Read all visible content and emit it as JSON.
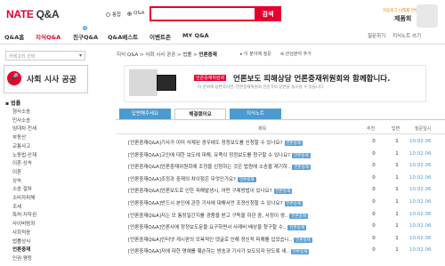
{
  "header": {
    "logo_main": "NATE",
    "logo_qa": "Q&A",
    "radio_all": "통합",
    "radio_qa": "Q&A",
    "search_button": "검색",
    "welcome": "자동로그 나래를 반반다",
    "username": "제품회"
  },
  "nav": {
    "items": [
      "Q&A홈",
      "지식Q&A",
      "친구Q&A",
      "Q&A베스트",
      "이벤트존",
      "MY Q&A"
    ],
    "new_badge": "N",
    "right_items": [
      "질문하기",
      "지식노트 쓰기"
    ]
  },
  "sidebar": {
    "category_select_placeholder": "카테고리 선택",
    "category_title": "사회 시사 공공",
    "law_section": "법률",
    "items": [
      "형사소송",
      "민사소송",
      "임대차·전세",
      "부동산",
      "교통사고",
      "노동법·산재",
      "이혼·상속",
      "이혼",
      "상속",
      "소송·절차",
      "소비자피해",
      "조세",
      "특허·저작권",
      "사이버범죄",
      "사회적응",
      "법률상식",
      "언론중재",
      "인권·평등"
    ]
  },
  "breadcrumb": {
    "path": "지식 Q&A > 사회 시사 공공 > 법률 >",
    "current": "언론중재",
    "tool1": "이 분야에 질문",
    "tool2": "관심분야 추가"
  },
  "banner": {
    "org_logo": "언론중재위원회",
    "title": "언론보도 피해상담 언론중재위원회와 함께합니다.",
    "subtitle": "이 분야에 답변하시면, 언론중재위원회 전문가의 답변을 들으실 수 있습니다."
  },
  "tabs": [
    "답변해주세요",
    "해결됐어요",
    "지식노트"
  ],
  "table": {
    "headers": [
      "제목",
      "추천",
      "답변",
      "질문일시"
    ],
    "tag_label": "언론중재",
    "rows": [
      {
        "title": "[언론중재Q&A]기사가 이미 삭제된 경우에도 정정보도를 신청할 수 있나요?",
        "rec": "0",
        "ans": "1",
        "date": "10.02.06"
      },
      {
        "title": "[언론중재Q&A]고인에 대한 보도에 대해, 유족이 정정보도를 청구할 수 있나요?",
        "rec": "0",
        "ans": "1",
        "date": "10.02.06"
      },
      {
        "title": "[언론중재Q&A]언론중재위원회에 조정을 신청하는 것은 법원에 소송을 제기하..",
        "rec": "0",
        "ans": "1",
        "date": "10.02.06"
      },
      {
        "title": "[언론중재Q&A]조정과 중재의 차이점은 무엇인가요?",
        "rec": "0",
        "ans": "1",
        "date": "10.02.06"
      },
      {
        "title": "[언론중재Q&A]언론보도로 인한 피해발생시, 어떤 구제방법이 있나요?",
        "rec": "0",
        "ans": "1",
        "date": "10.02.06"
      },
      {
        "title": "[언론중재Q&A]반드시 본인에 관한 기사에 대해서만 조정신청할 수 있나요?",
        "rec": "0",
        "ans": "1",
        "date": "10.02.06"
      },
      {
        "title": "[언론중재Q&A]저는 모 통장일간지를 경품을 받고 구독을 하던 중, 사정이 생..",
        "rec": "0",
        "ans": "1",
        "date": "10.02.06"
      },
      {
        "title": "[언론중재Q&A]언론사에 정정보도문을 요구하면서 사례비 배상을 청구할 수..",
        "rec": "0",
        "ans": "1",
        "date": "10.02.06"
      },
      {
        "title": "[언론중재Q&A]인터넷 게시판의 모욕적인 댓글로 인해 정신적 피해를 입었습니..",
        "rec": "0",
        "ans": "1",
        "date": "10.02.06"
      },
      {
        "title": "[언론중재Q&A]저에 대한 명예를 훼손하는 방송과 기사가 보도되자 당도록 새..",
        "rec": "0",
        "ans": "1",
        "date": "10.02.06"
      }
    ]
  },
  "colors": {
    "brand_red": "#e5002d",
    "tab_blue": "#4a9bd0"
  }
}
